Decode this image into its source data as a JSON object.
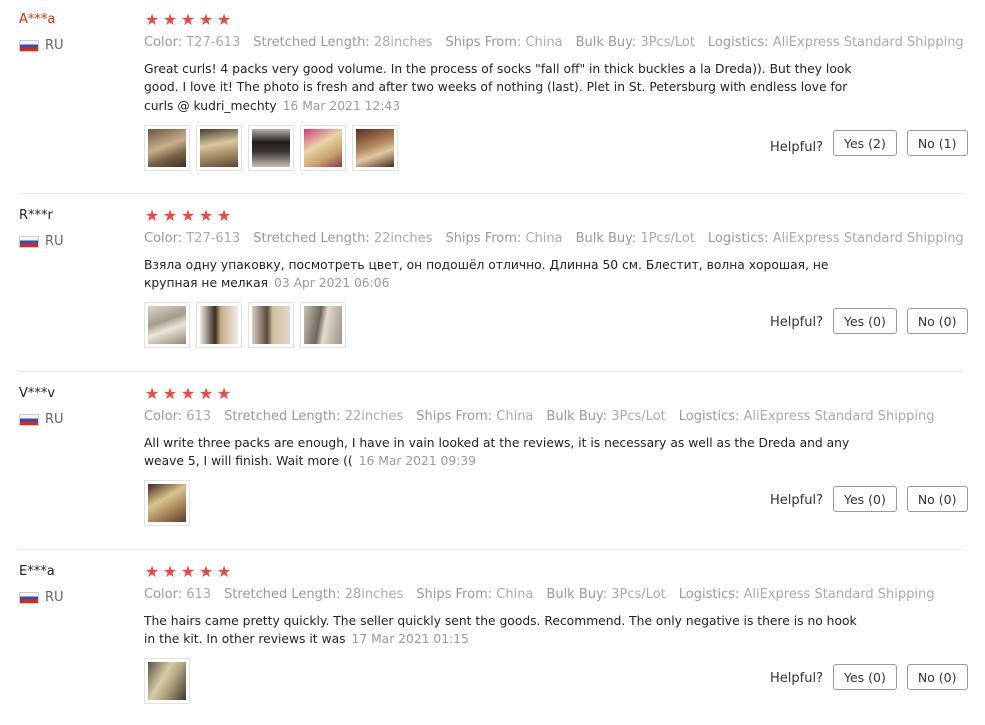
{
  "labels": {
    "color": "Color:",
    "stretched_length": "Stretched Length:",
    "ships_from": "Ships From:",
    "bulk_buy": "Bulk Buy:",
    "logistics": "Logistics:",
    "helpful": "Helpful?"
  },
  "colors": {
    "star": "#f04645",
    "first_username": "#e62e04",
    "separator": "#e8e8e8"
  },
  "reviews": [
    {
      "user": "A***a",
      "country": "RU",
      "stars": 5,
      "color": "T27-613",
      "stretched_length": "28inches",
      "ships_from": "China",
      "bulk_buy": "3Pcs/Lot",
      "logistics": "AliExpress Standard Shipping",
      "text": "Great curls! 4 packs very good volume. In the process of socks \"fall off\" in thick buckles a la Dreda)). But they look good. I love it! The photo is fresh and after two weeks of nothing (last). Plet in St. Petersburg with endless love for curls @ kudri_mechty",
      "date": "16 Mar 2021 12:43",
      "photos": 5,
      "yes": "Yes (2)",
      "no": "No (1)"
    },
    {
      "user": "R***r",
      "country": "RU",
      "stars": 5,
      "color": "T27-613",
      "stretched_length": "22inches",
      "ships_from": "China",
      "bulk_buy": "1Pcs/Lot",
      "logistics": "AliExpress Standard Shipping",
      "text": "Взяла одну упаковку, посмотреть цвет, он подошёл отлично. Длинна 50 см. Блестит, волна хорошая, не крупная не мелкая",
      "date": "03 Apr 2021 06:06",
      "photos": 4,
      "yes": "Yes (0)",
      "no": "No (0)"
    },
    {
      "user": "V***v",
      "country": "RU",
      "stars": 5,
      "color": "613",
      "stretched_length": "22inches",
      "ships_from": "China",
      "bulk_buy": "3Pcs/Lot",
      "logistics": "AliExpress Standard Shipping",
      "text": "All write three packs are enough, I have in vain looked at the reviews, it is necessary as well as the Dreda and any weave 5, I will finish. Wait more ((",
      "date": "16 Mar 2021 09:39",
      "photos": 1,
      "yes": "Yes (0)",
      "no": "No (0)"
    },
    {
      "user": "E***a",
      "country": "RU",
      "stars": 5,
      "color": "613",
      "stretched_length": "28inches",
      "ships_from": "China",
      "bulk_buy": "3Pcs/Lot",
      "logistics": "AliExpress Standard Shipping",
      "text": "The hairs came pretty quickly. The seller quickly sent the goods. Recommend. The only negative is there is no hook in the kit. In other reviews it was",
      "date": "17 Mar 2021 01:15",
      "photos": 1,
      "yes": "Yes (0)",
      "no": "No (0)"
    }
  ]
}
